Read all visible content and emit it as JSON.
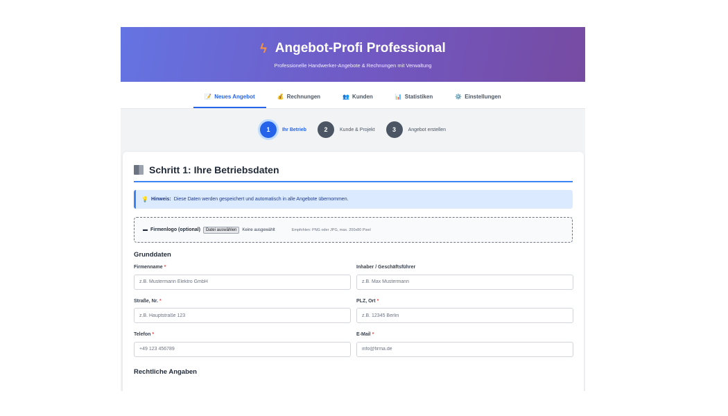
{
  "header": {
    "title": "Angebot-Profi Professional",
    "subtitle": "Professionelle Handwerker-Angebote & Rechnungen mit Verwaltung",
    "icon": "bolt-icon",
    "gradient": [
      "#667eea",
      "#764ba2"
    ]
  },
  "tabs": [
    {
      "label": "Neues Angebot",
      "icon": "📝",
      "active": true
    },
    {
      "label": "Rechnungen",
      "icon": "💰",
      "active": false
    },
    {
      "label": "Kunden",
      "icon": "👥",
      "active": false
    },
    {
      "label": "Statistiken",
      "icon": "📊",
      "active": false
    },
    {
      "label": "Einstellungen",
      "icon": "⚙️",
      "active": false
    }
  ],
  "steps": [
    {
      "num": "1",
      "label": "Ihr Betrieb",
      "active": true
    },
    {
      "num": "2",
      "label": "Kunde & Projekt",
      "active": false
    },
    {
      "num": "3",
      "label": "Angebot erstellen",
      "active": false
    }
  ],
  "card": {
    "title": "Schritt 1: Ihre Betriebsdaten",
    "notice_label": "Hinweis:",
    "notice_text": "Diese Daten werden gespeichert und automatisch in alle Angebote übernommen.",
    "logo_label": "Firmenlogo (optional)",
    "logo_button": "Datei auswählen",
    "logo_none": "Keine ausgewählt",
    "logo_hint": "Empfohlen: PNG oder JPG, max. 200x80 Pixel",
    "section_basic": "Grunddaten",
    "section_legal": "Rechtliche Angaben"
  },
  "fields": [
    {
      "label": "Firmenname",
      "required": "*",
      "placeholder": "z.B. Mustermann Elektro GmbH"
    },
    {
      "label": "Inhaber / Geschäftsführer",
      "required": "",
      "placeholder": "z.B. Max Mustermann"
    },
    {
      "label": "Straße, Nr.",
      "required": "*",
      "placeholder": "z.B. Hauptstraße 123"
    },
    {
      "label": "PLZ, Ort",
      "required": "*",
      "placeholder": "z.B. 12345 Berlin"
    },
    {
      "label": "Telefon",
      "required": "*",
      "placeholder": "+49 123 456789"
    },
    {
      "label": "E-Mail",
      "required": "*",
      "placeholder": "info@firma.de"
    }
  ],
  "colors": {
    "accent": "#2563eb",
    "required": "#ef4444",
    "notice_bg": "#dbeafe"
  }
}
